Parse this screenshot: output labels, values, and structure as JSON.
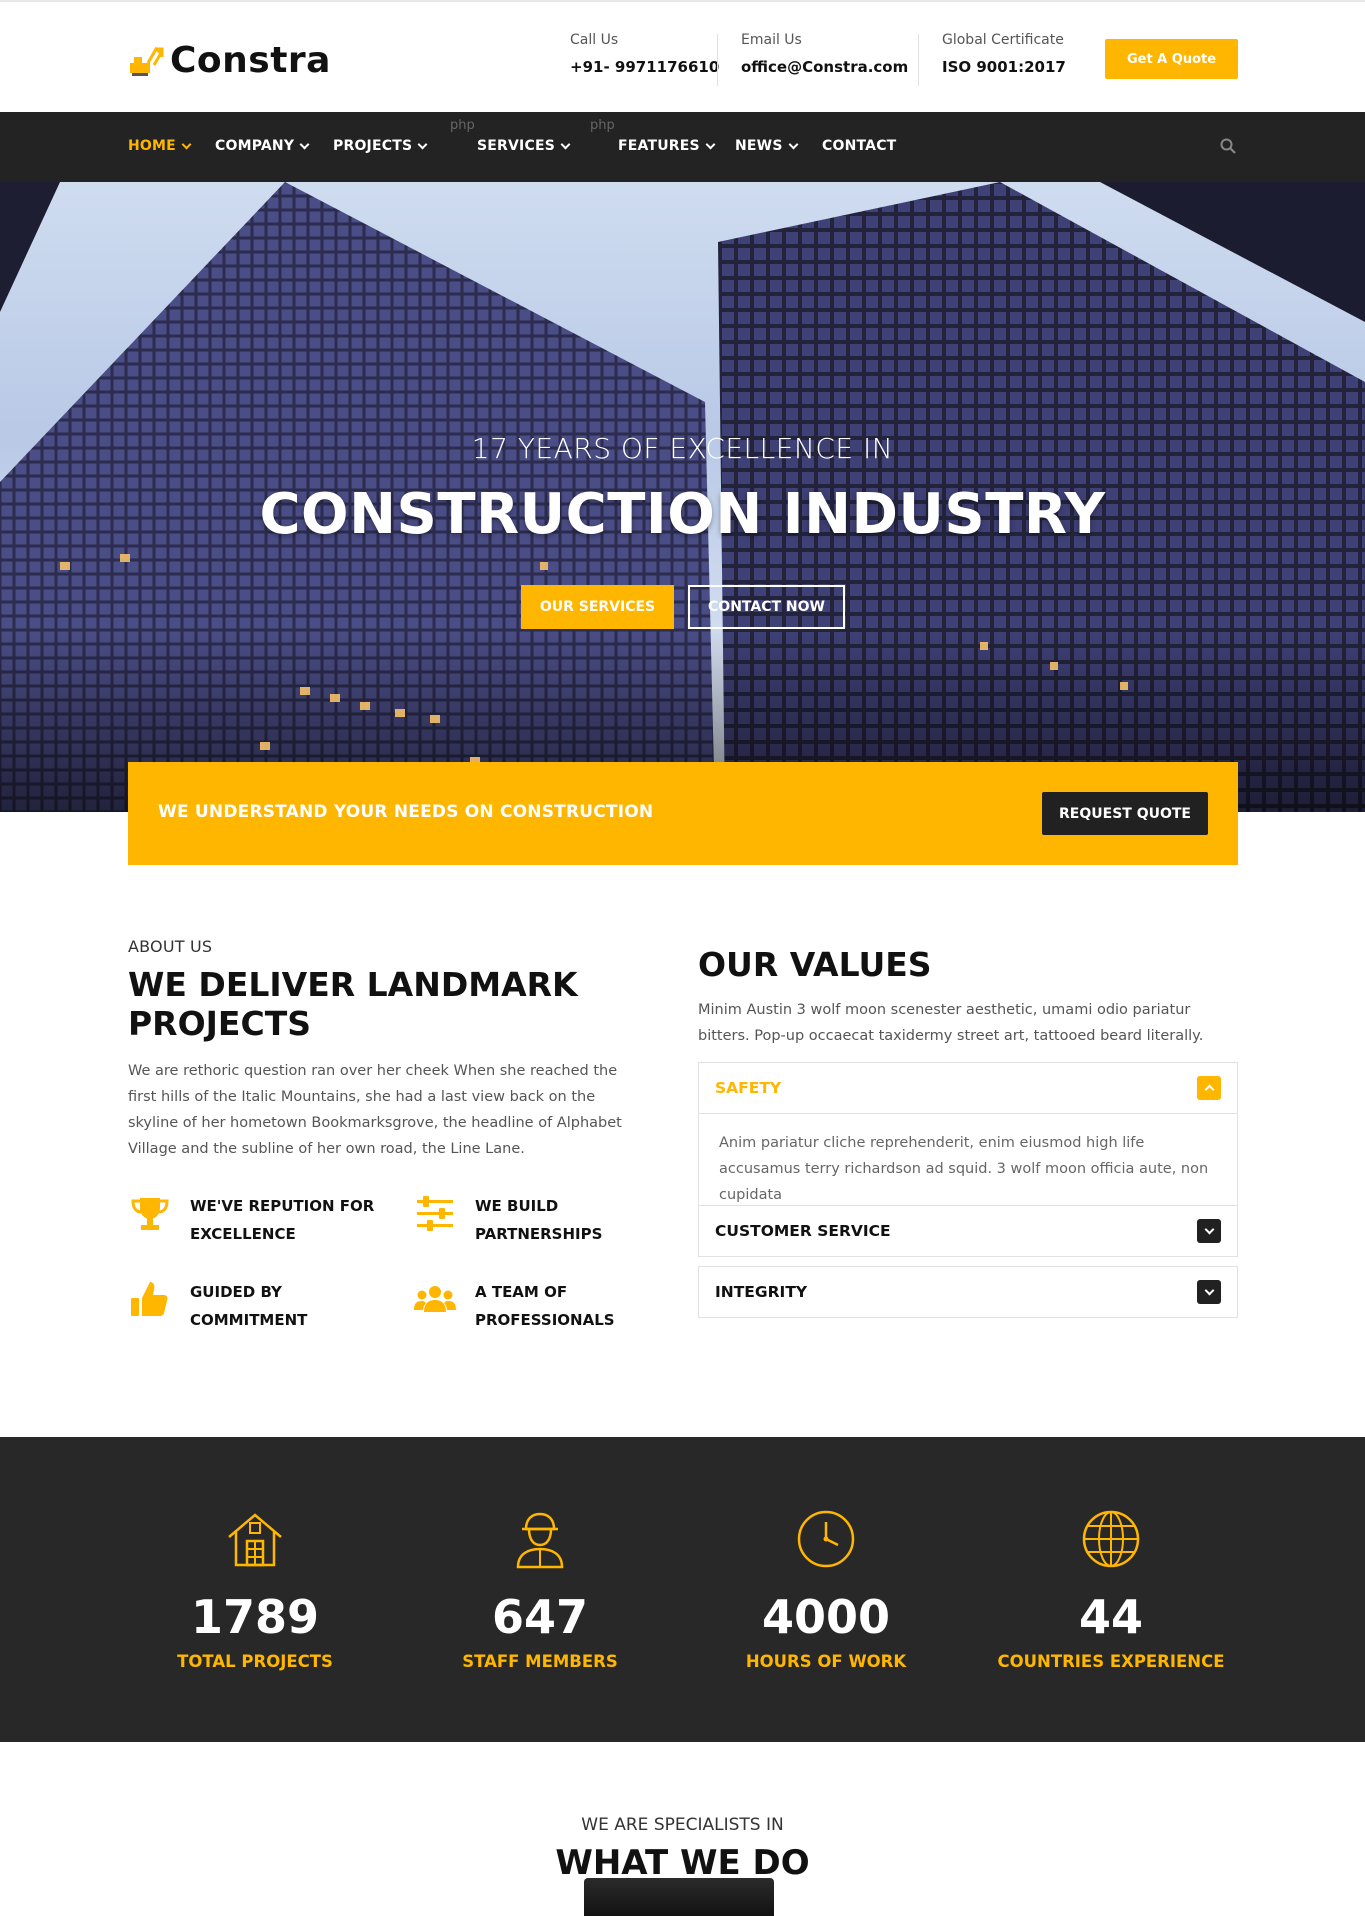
{
  "brand": {
    "name": "Constra"
  },
  "topbar": {
    "call": {
      "label": "Call Us",
      "value": "+91- 9971176610"
    },
    "email": {
      "label": "Email Us",
      "value": "office@Constra.com"
    },
    "cert": {
      "label": "Global Certificate",
      "value": "ISO 9001:2017"
    },
    "quote_button": "Get A Quote"
  },
  "nav": {
    "items": [
      {
        "label": "HOME",
        "caret": true,
        "active": true
      },
      {
        "label": "COMPANY",
        "caret": true
      },
      {
        "label": "PROJECTS",
        "caret": true
      },
      {
        "label": "SERVICES",
        "caret": true
      },
      {
        "label": "FEATURES",
        "caret": true
      },
      {
        "label": "NEWS",
        "caret": true
      },
      {
        "label": "CONTACT",
        "caret": false
      }
    ],
    "php_tags": [
      "php",
      "php"
    ],
    "search_icon": "search-icon"
  },
  "hero": {
    "subtitle": "17 YEARS OF EXCELLENCE IN",
    "title": "CONSTRUCTION INDUSTRY",
    "primary_button": "OUR SERVICES",
    "secondary_button": "CONTACT NOW"
  },
  "cta": {
    "text": "WE UNDERSTAND YOUR NEEDS ON CONSTRUCTION",
    "button": "REQUEST QUOTE"
  },
  "about": {
    "kicker": "ABOUT US",
    "title": "WE DELIVER LANDMARK PROJECTS",
    "text": "We are rethoric question ran over her cheek When she reached the first hills of the Italic Mountains, she had a last view back on the skyline of her hometown Bookmarksgrove, the headline of Alphabet Village and the subline of her own road, the Line Lane.",
    "features": [
      {
        "icon": "trophy-icon",
        "label": "WE'VE REPUTION FOR EXCELLENCE"
      },
      {
        "icon": "sliders-icon",
        "label": "WE BUILD PARTNERSHIPS"
      },
      {
        "icon": "thumbs-up-icon",
        "label": "GUIDED BY COMMITMENT"
      },
      {
        "icon": "users-icon",
        "label": "A TEAM OF PROFESSIONALS"
      }
    ]
  },
  "values": {
    "title": "OUR VALUES",
    "text": "Minim Austin 3 wolf moon scenester aesthetic, umami odio pariatur bitters. Pop-up occaecat taxidermy street art, tattooed beard literally.",
    "accordion": [
      {
        "title": "SAFETY",
        "open": true,
        "body": "Anim pariatur cliche reprehenderit, enim eiusmod high life accusamus terry richardson ad squid. 3 wolf moon officia aute, non cupidata"
      },
      {
        "title": "CUSTOMER SERVICE",
        "open": false
      },
      {
        "title": "INTEGRITY",
        "open": false
      }
    ]
  },
  "stats": [
    {
      "icon": "house-icon",
      "number": "1789",
      "label": "TOTAL PROJECTS"
    },
    {
      "icon": "worker-icon",
      "number": "647",
      "label": "STAFF MEMBERS"
    },
    {
      "icon": "clock-icon",
      "number": "4000",
      "label": "HOURS OF WORK"
    },
    {
      "icon": "globe-icon",
      "number": "44",
      "label": "COUNTRIES EXPERIENCE"
    }
  ],
  "what_we_do": {
    "kicker": "WE ARE SPECIALISTS IN",
    "title": "WHAT WE DO"
  },
  "colors": {
    "accent": "#ffb600",
    "dark": "#232323",
    "stats_bg": "#282828"
  }
}
